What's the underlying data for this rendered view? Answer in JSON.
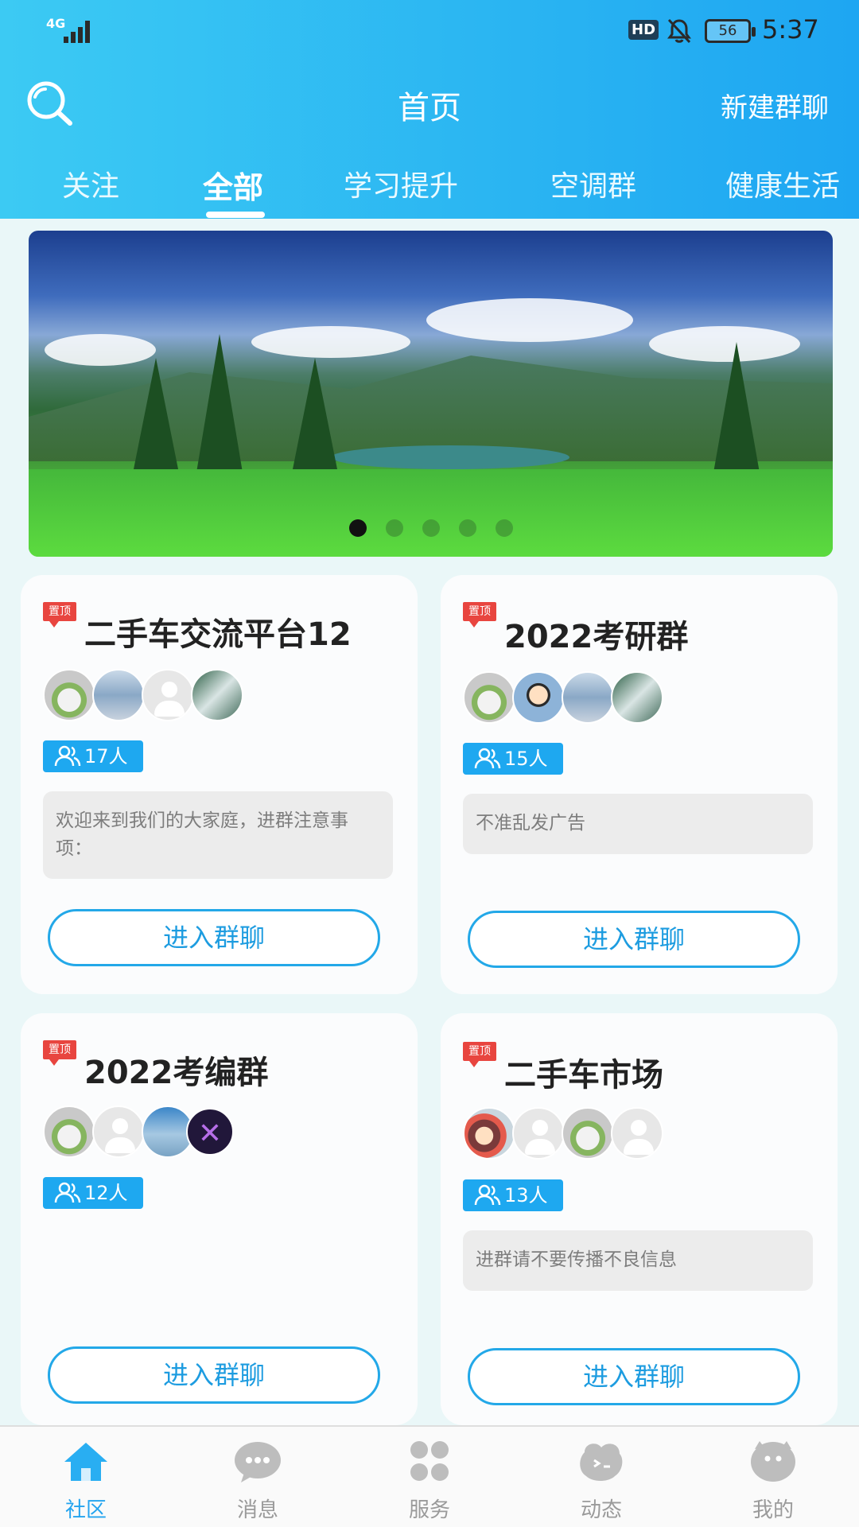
{
  "status_bar": {
    "network": "4G",
    "hd": "HD",
    "battery": "56",
    "time": "5:37"
  },
  "header": {
    "title": "首页",
    "new_group": "新建群聊"
  },
  "tabs": [
    {
      "label": "关注",
      "active": false
    },
    {
      "label": "全部",
      "active": true
    },
    {
      "label": "学习提升",
      "active": false
    },
    {
      "label": "空调群",
      "active": false
    },
    {
      "label": "健康生活",
      "active": false
    }
  ],
  "banner": {
    "slides": 5,
    "active_slide": 1
  },
  "cards": [
    {
      "pin": "置顶",
      "title": "二手车交流平台12",
      "count": "17人",
      "notice": "欢迎来到我们的大家庭，进群注意事项：",
      "enter": "进入群聊"
    },
    {
      "pin": "置顶",
      "title": "2022考研群",
      "count": "15人",
      "notice": "不准乱发广告",
      "enter": "进入群聊"
    },
    {
      "pin": "置顶",
      "title": "2022考编群",
      "count": "12人",
      "notice": "",
      "enter": "进入群聊"
    },
    {
      "pin": "置顶",
      "title": "二手车市场",
      "count": "13人",
      "notice": "进群请不要传播不良信息",
      "enter": "进入群聊"
    }
  ],
  "bottom_nav": [
    {
      "label": "社区",
      "icon": "home-icon",
      "active": true
    },
    {
      "label": "消息",
      "icon": "chat-icon",
      "active": false
    },
    {
      "label": "服务",
      "icon": "clover-icon",
      "active": false
    },
    {
      "label": "动态",
      "icon": "dynamic-icon",
      "active": false
    },
    {
      "label": "我的",
      "icon": "profile-icon",
      "active": false
    }
  ],
  "colors": {
    "accent": "#1ea8f0",
    "header_start": "#3ccaf3",
    "header_end": "#1ea6f2",
    "pin": "#e8453f"
  }
}
